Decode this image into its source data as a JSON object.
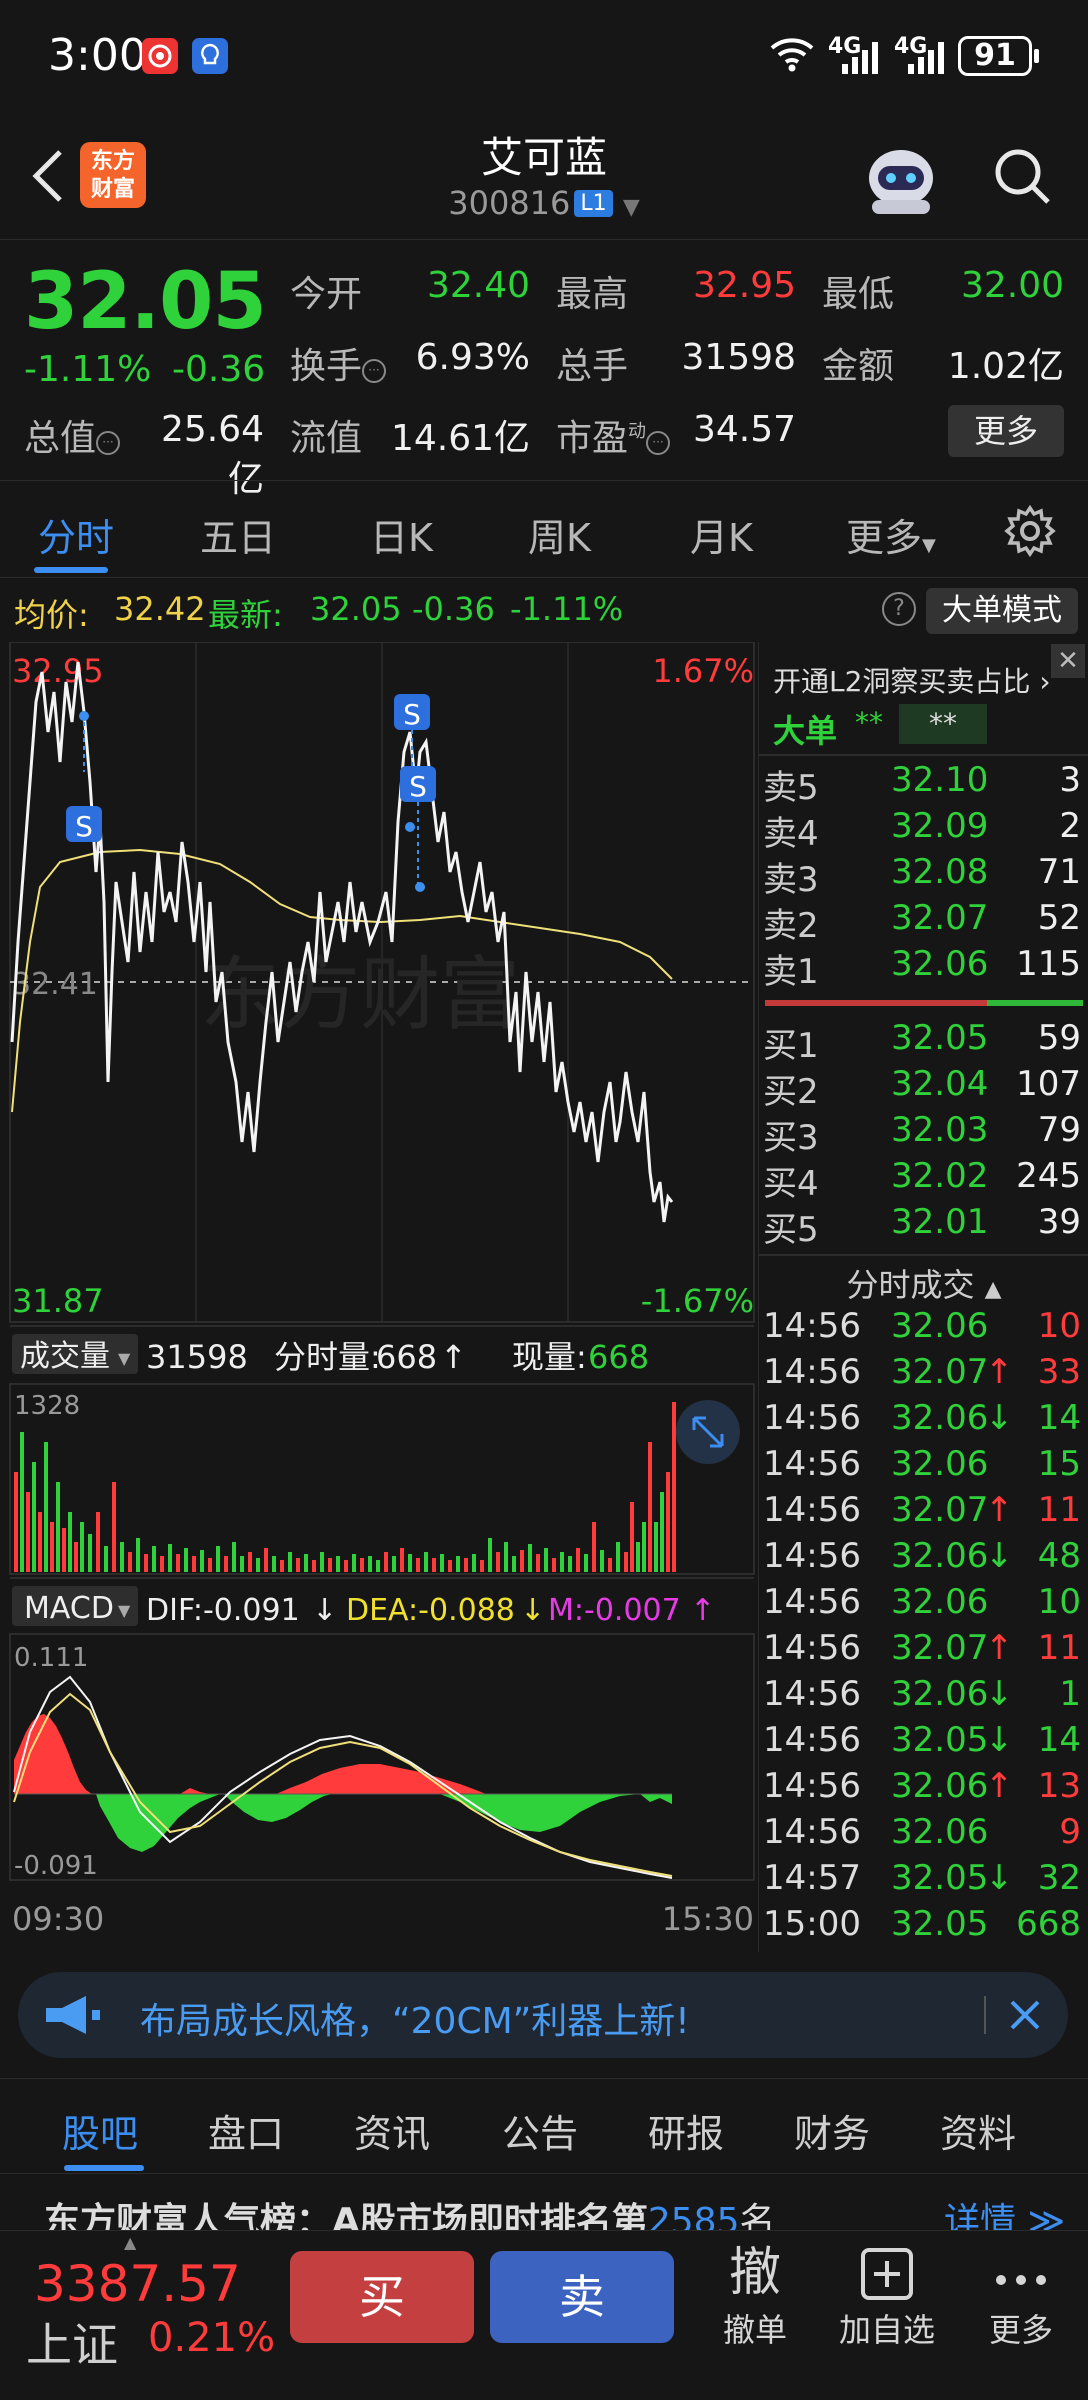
{
  "status_bar": {
    "time": "3:00",
    "network1": "4G",
    "network2": "4G",
    "battery": "91"
  },
  "header": {
    "logo_line1": "东方",
    "logo_line2": "财富",
    "stock_name": "艾可蓝",
    "stock_code": "300816",
    "level_badge": "L1"
  },
  "quote": {
    "price": "32.05",
    "change_pct": "-1.11%",
    "change_abs": "-0.36",
    "open_label": "今开",
    "open": "32.40",
    "high_label": "最高",
    "high": "32.95",
    "low_label": "最低",
    "low": "32.00",
    "turnover_label": "换手",
    "turnover": "6.93%",
    "volume_label": "总手",
    "volume": "31598",
    "amount_label": "金额",
    "amount": "1.02亿",
    "mktcap_label": "总值",
    "mktcap": "25.64亿",
    "float_label": "流值",
    "float": "14.61亿",
    "pe_label": "市盈",
    "pe_sup": "动",
    "pe": "34.57",
    "more_label": "更多"
  },
  "chart_tabs": [
    {
      "label": "分时"
    },
    {
      "label": "五日"
    },
    {
      "label": "日K"
    },
    {
      "label": "周K"
    },
    {
      "label": "月K"
    },
    {
      "label": "更多"
    }
  ],
  "avg_row": {
    "avg_label": "均价:",
    "avg_value": "32.42",
    "latest_label": "最新:",
    "latest_value": "32.05",
    "latest_chg": "-0.36",
    "latest_pct": "-1.11%",
    "help_glyph": "?",
    "big_order_btn": "大单模式"
  },
  "price_chart": {
    "high_label": "32.95",
    "low_label": "31.87",
    "mid_label": "32.41",
    "up_pct": "1.67%",
    "down_pct": "-1.67%",
    "watermark": "东方财富",
    "marker_label": "S",
    "start_time": "09:30",
    "end_time": "15:30"
  },
  "volume_panel": {
    "selector": "成交量",
    "total": "31598",
    "tick_vol_label": "分时量:",
    "tick_vol": "668",
    "tick_vol_arrow": "↑",
    "now_label": "现量:",
    "now_vol": "668",
    "max_label": "1328"
  },
  "macd_panel": {
    "selector": "MACD",
    "dif": "DIF:-0.091",
    "dif_arrow": "↓",
    "dea": "DEA:-0.088",
    "dea_arrow": "↓",
    "m": "M:-0.007",
    "m_arrow": "↑",
    "top_label": "0.111",
    "bottom_label": "-0.091"
  },
  "orderbook": {
    "promo": "开通L2洞察买卖占比",
    "big_label": "大单",
    "big_val1": "**",
    "big_val2": "**",
    "asks": [
      {
        "label": "卖5",
        "price": "32.10",
        "vol": "3"
      },
      {
        "label": "卖4",
        "price": "32.09",
        "vol": "2"
      },
      {
        "label": "卖3",
        "price": "32.08",
        "vol": "71"
      },
      {
        "label": "卖2",
        "price": "32.07",
        "vol": "52"
      },
      {
        "label": "卖1",
        "price": "32.06",
        "vol": "115"
      }
    ],
    "bids": [
      {
        "label": "买1",
        "price": "32.05",
        "vol": "59"
      },
      {
        "label": "买2",
        "price": "32.04",
        "vol": "107"
      },
      {
        "label": "买3",
        "price": "32.03",
        "vol": "79"
      },
      {
        "label": "买4",
        "price": "32.02",
        "vol": "245"
      },
      {
        "label": "买5",
        "price": "32.01",
        "vol": "39"
      }
    ],
    "ticks_title": "分时成交",
    "ticks": [
      {
        "time": "14:56",
        "price": "32.06",
        "arrow": "",
        "vol": "10",
        "dir": "up"
      },
      {
        "time": "14:56",
        "price": "32.07",
        "arrow": "↑",
        "vol": "33",
        "dir": "up"
      },
      {
        "time": "14:56",
        "price": "32.06",
        "arrow": "↓",
        "vol": "14",
        "dir": "down"
      },
      {
        "time": "14:56",
        "price": "32.06",
        "arrow": "",
        "vol": "15",
        "dir": "down"
      },
      {
        "time": "14:56",
        "price": "32.07",
        "arrow": "↑",
        "vol": "11",
        "dir": "up"
      },
      {
        "time": "14:56",
        "price": "32.06",
        "arrow": "↓",
        "vol": "48",
        "dir": "down"
      },
      {
        "time": "14:56",
        "price": "32.06",
        "arrow": "",
        "vol": "10",
        "dir": "down"
      },
      {
        "time": "14:56",
        "price": "32.07",
        "arrow": "↑",
        "vol": "11",
        "dir": "up"
      },
      {
        "time": "14:56",
        "price": "32.06",
        "arrow": "↓",
        "vol": "1",
        "dir": "down"
      },
      {
        "time": "14:56",
        "price": "32.05",
        "arrow": "↓",
        "vol": "14",
        "dir": "down"
      },
      {
        "time": "14:56",
        "price": "32.06",
        "arrow": "↑",
        "vol": "13",
        "dir": "up"
      },
      {
        "time": "14:56",
        "price": "32.06",
        "arrow": "",
        "vol": "9",
        "dir": "up"
      },
      {
        "time": "14:57",
        "price": "32.05",
        "arrow": "↓",
        "vol": "32",
        "dir": "down"
      },
      {
        "time": "15:00",
        "price": "32.05",
        "arrow": "",
        "vol": "668",
        "dir": "down"
      }
    ]
  },
  "banner": {
    "text": "布局成长风格，“20CM”利器上新!"
  },
  "info_tabs": [
    {
      "label": "股吧"
    },
    {
      "label": "盘口"
    },
    {
      "label": "资讯"
    },
    {
      "label": "公告"
    },
    {
      "label": "研报"
    },
    {
      "label": "财务"
    },
    {
      "label": "资料"
    }
  ],
  "peek": {
    "text": "东方财富人气榜：A股市场即时排名第",
    "rank": "2585",
    "suffix": "名",
    "link": "详情 ≫"
  },
  "bottom_bar": {
    "index_value": "3387.57",
    "index_name": "上证",
    "index_pct": "0.21%",
    "buy": "买",
    "sell": "卖",
    "cancel_icon": "撤",
    "cancel_label": "撤单",
    "add_label": "加自选",
    "more_label": "更多"
  },
  "colors": {
    "up": "#ff3b3b",
    "down": "#2fd23a",
    "accent": "#3c8ef0",
    "avg_line": "#f0e07a"
  }
}
